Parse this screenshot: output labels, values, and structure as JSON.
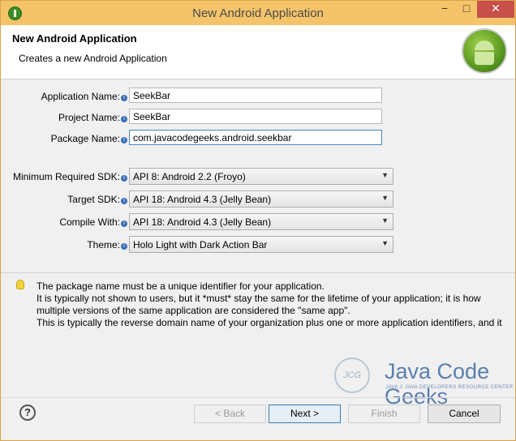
{
  "window": {
    "title": "New Android Application",
    "controls": {
      "minimize": "−",
      "maximize": "□",
      "close": "✕"
    }
  },
  "header": {
    "title": "New Android Application",
    "subtitle": "Creates a new Android Application",
    "logo_icon": "android-robot-icon"
  },
  "form": {
    "application_name": {
      "label": "Application Name:",
      "value": "SeekBar"
    },
    "project_name": {
      "label": "Project Name:",
      "value": "SeekBar"
    },
    "package_name": {
      "label": "Package Name:",
      "value": "com.javacodegeeks.android.seekbar"
    },
    "min_sdk": {
      "label": "Minimum Required SDK:",
      "value": "API 8: Android 2.2 (Froyo)"
    },
    "target_sdk": {
      "label": "Target SDK:",
      "value": "API 18: Android 4.3 (Jelly Bean)"
    },
    "compile_with": {
      "label": "Compile With:",
      "value": "API 18: Android 4.3 (Jelly Bean)"
    },
    "theme": {
      "label": "Theme:",
      "value": "Holo Light with Dark Action Bar"
    },
    "info_glyph": "i"
  },
  "message": {
    "line1": "The package name must be a unique identifier for your application.",
    "line2": "It is typically not shown to users, but it *must* stay the same for the lifetime of your application; it is how",
    "line3": "multiple versions of the same application are considered the \"same app\".",
    "line4": "This is typically the reverse domain name of your organization plus one or more application identifiers, and it"
  },
  "watermark": {
    "logo_text": "JCG",
    "title": "Java Code Geeks",
    "subtitle": "JAVA 2 JAVA DEVELOPERS RESOURCE CENTER"
  },
  "buttons": {
    "help": "?",
    "back": "< Back",
    "next": "Next >",
    "finish": "Finish",
    "cancel": "Cancel"
  },
  "colors": {
    "titlebar": "#f5c46a",
    "close": "#c7504a",
    "accent": "#3c7fb1"
  }
}
